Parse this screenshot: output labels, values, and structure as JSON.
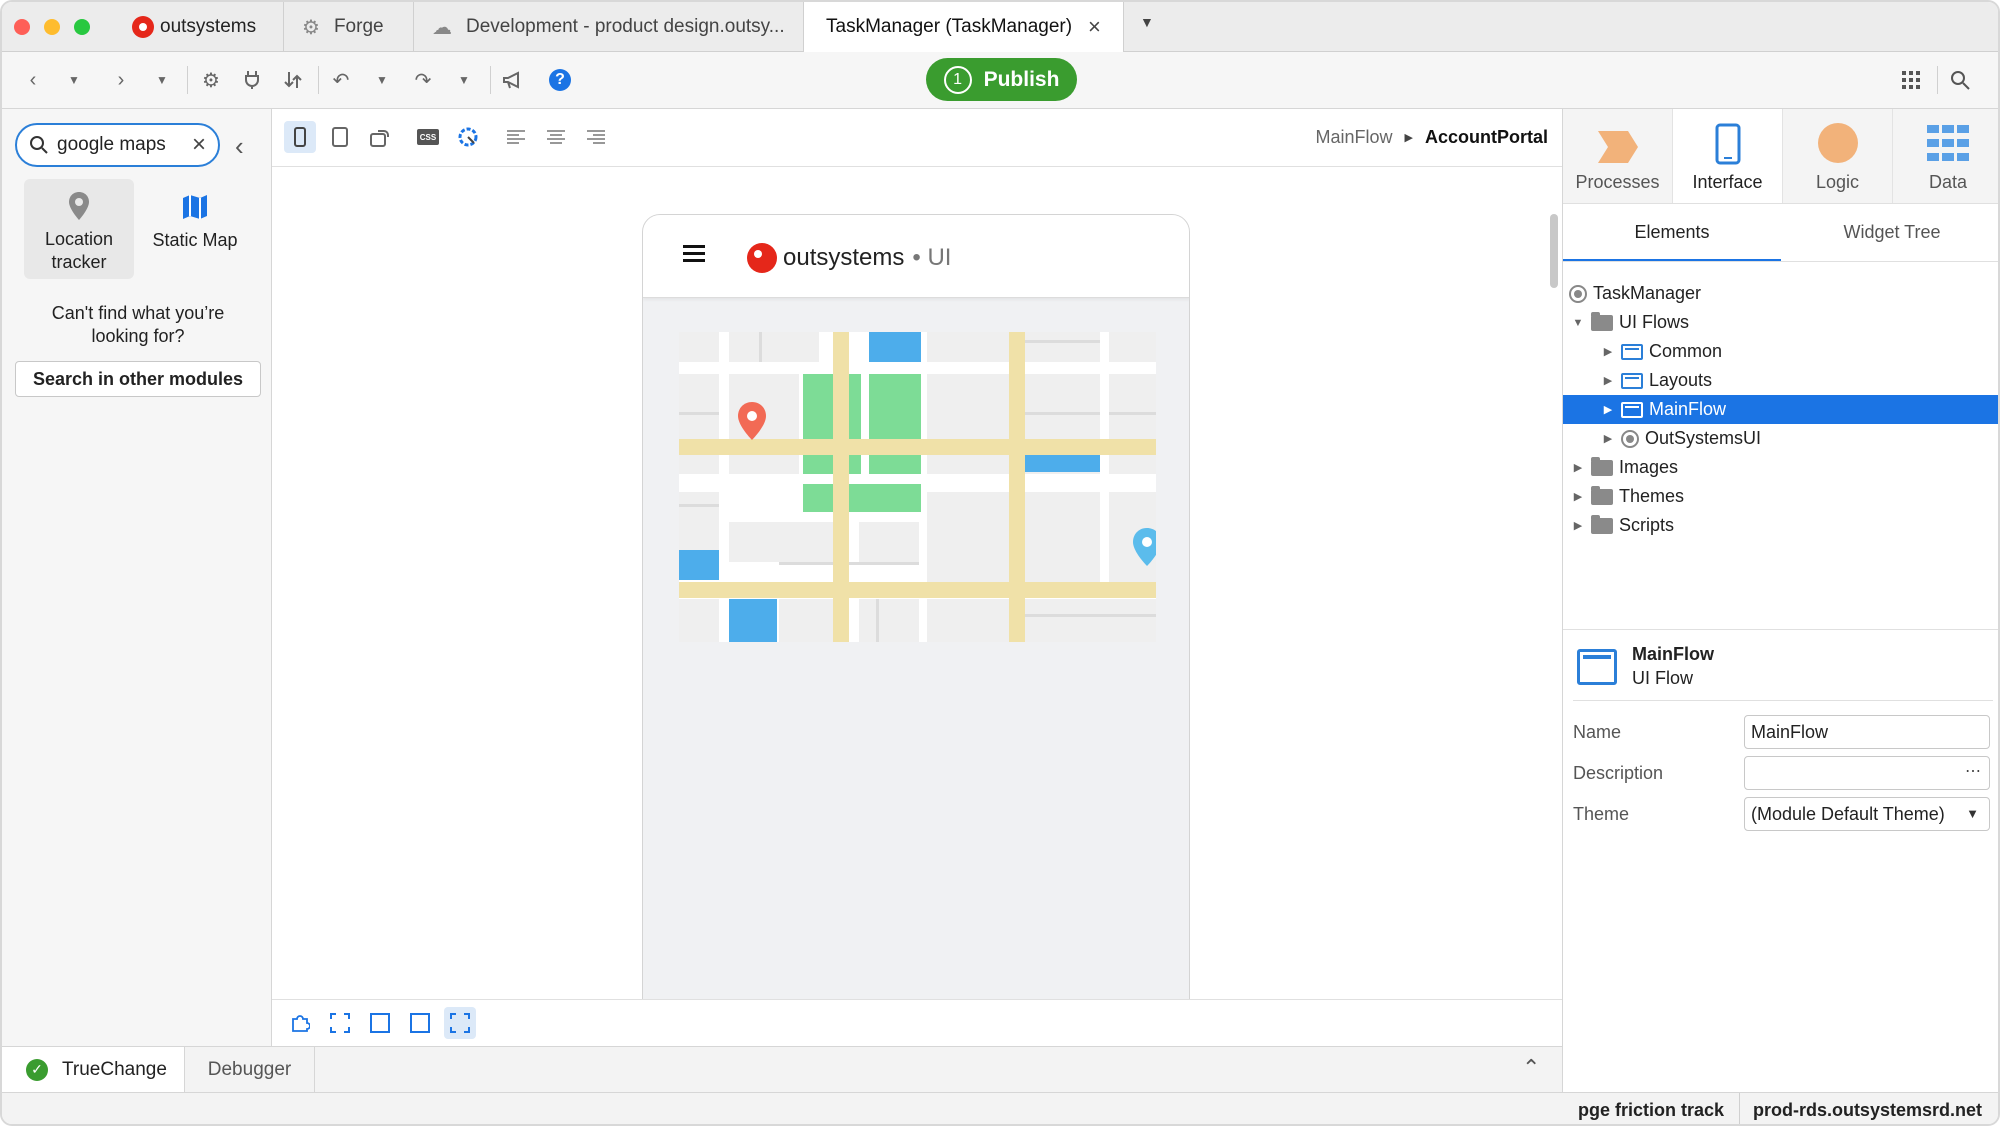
{
  "window": {
    "tabs": [
      {
        "label": "outsystems",
        "icon": "outsystems-logo-icon"
      },
      {
        "label": "Forge",
        "icon": "forge-gear-icon"
      },
      {
        "label": "Development - product design.outsy...",
        "icon": "cloud-icon"
      },
      {
        "label": "TaskManager (TaskManager)",
        "icon": "close-icon"
      }
    ]
  },
  "toolbar": {
    "publish_label": "Publish",
    "publish_count": "1"
  },
  "left_panel": {
    "search_value": "google maps",
    "results": [
      {
        "label": "Location tracker",
        "icon": "location-pin-icon"
      },
      {
        "label": "Static Map",
        "icon": "map-icon"
      }
    ],
    "not_found_text": "Can't find what you’re looking for?",
    "search_modules_label": "Search in other modules"
  },
  "canvas": {
    "breadcrumb": {
      "flow": "MainFlow",
      "screen": "AccountPortal"
    },
    "app_header": {
      "brand": "outsystems",
      "suffix": "• UI"
    }
  },
  "bottom": {
    "truechange_label": "TrueChange",
    "debugger_label": "Debugger"
  },
  "status": {
    "user": "pge friction track",
    "server": "prod-rds.outsystemsrd.net"
  },
  "right_panel": {
    "tabs": [
      {
        "label": "Processes",
        "color": "#f2b27a"
      },
      {
        "label": "Interface",
        "color": "#2b7fd8"
      },
      {
        "label": "Logic",
        "color": "#f2b27a"
      },
      {
        "label": "Data",
        "color": "#5aa0e6"
      }
    ],
    "subtabs": {
      "elements": "Elements",
      "widget_tree": "Widget Tree"
    },
    "tree": {
      "root": "TaskManager",
      "ui_flows": "UI Flows",
      "common": "Common",
      "layouts": "Layouts",
      "mainflow": "MainFlow",
      "outsystemsui": "OutSystemsUI",
      "images": "Images",
      "themes": "Themes",
      "scripts": "Scripts"
    },
    "properties": {
      "title": "MainFlow",
      "subtitle": "UI Flow",
      "name_label": "Name",
      "name_value": "MainFlow",
      "description_label": "Description",
      "description_value": "",
      "theme_label": "Theme",
      "theme_value": "(Module Default Theme)"
    }
  },
  "colors": {
    "accent": "#1b74e4",
    "publish": "#3a9c2f",
    "brand_red": "#e5271a"
  }
}
